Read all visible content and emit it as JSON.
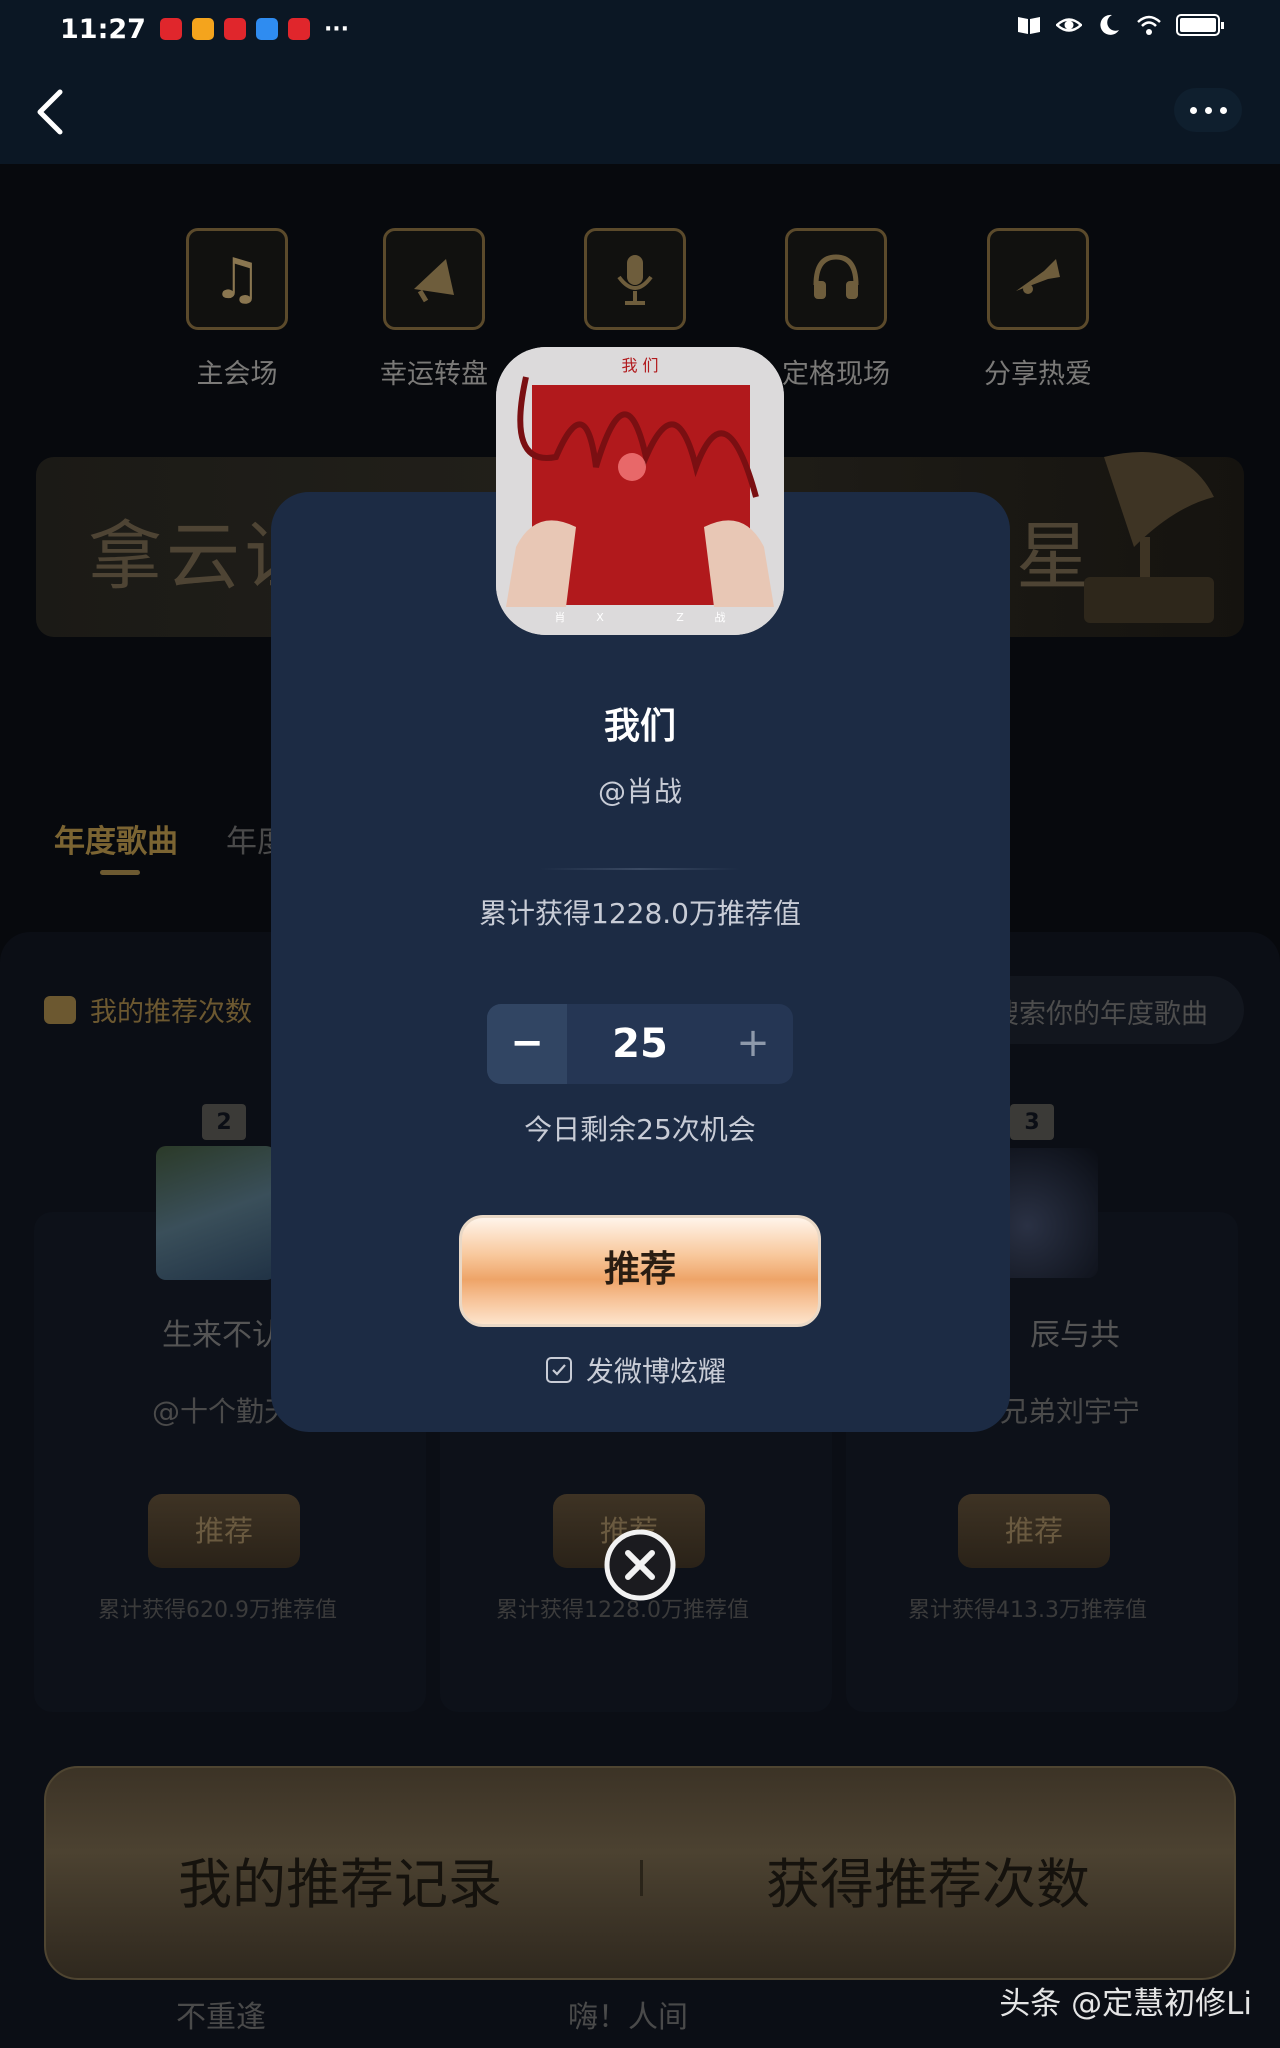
{
  "status_bar": {
    "time": "11:27",
    "notification_app_colors": [
      "#e0262c",
      "#f4a41d",
      "#e0262c",
      "#2f8cf0",
      "#e0262c"
    ],
    "more": "···"
  },
  "top_bar": {
    "back_icon": "chevron-left-icon",
    "more_icon": "more-dots-icon"
  },
  "nav": {
    "items": [
      {
        "label": "主会场",
        "icon": "music-note-icon"
      },
      {
        "label": "幸运转盘",
        "icon": "megaphone-icon"
      },
      {
        "label": "",
        "icon": "microphone-icon"
      },
      {
        "label": "定格现场",
        "icon": "headphones-icon"
      },
      {
        "label": "分享热爱",
        "icon": "trumpet-icon"
      }
    ]
  },
  "banner": {
    "left_text": "拿云证",
    "right_text": "星"
  },
  "tabs": {
    "active": "年度歌曲",
    "second": "年度"
  },
  "recommend_count_label": "我的推荐次数",
  "search_placeholder": "搜索你的年度歌曲",
  "ranking": {
    "rank_2": "2",
    "rank_3": "3",
    "cards": [
      {
        "song": "生来不认",
        "artist": "@十个勤天",
        "button": "推荐",
        "total": "累计获得620.9万推荐值"
      },
      {
        "song": "",
        "artist": "",
        "button": "推荐",
        "total": "累计获得1228.0万推荐值"
      },
      {
        "song": "辰与共",
        "artist": "兄弟刘宇宁",
        "button": "推荐",
        "total": "累计获得413.3万推荐值"
      }
    ]
  },
  "bottom_bar": {
    "left": "我的推荐记录",
    "right": "获得推荐次数"
  },
  "bottom_peek": {
    "left": "不重逢",
    "middle": "嗨！人间"
  },
  "watermark": "头条 @定慧初修Li",
  "modal": {
    "cover_title": "我 们",
    "cover_letters": [
      "肖",
      "X",
      "Z",
      "战"
    ],
    "title": "我们",
    "artist": "@肖战",
    "total": "累计获得1228.0万推荐值",
    "stepper": {
      "minus": "−",
      "value": "25",
      "plus": "+"
    },
    "remaining": "今日剩余25次机会",
    "recommend_button": "推荐",
    "weibo_label": "发微博炫耀",
    "weibo_checked": true,
    "close_icon": "close-circle-icon"
  },
  "colors": {
    "modal_bg": "#1c2b44",
    "button_orange": "#eea468",
    "gold_accent": "#7b6432"
  }
}
